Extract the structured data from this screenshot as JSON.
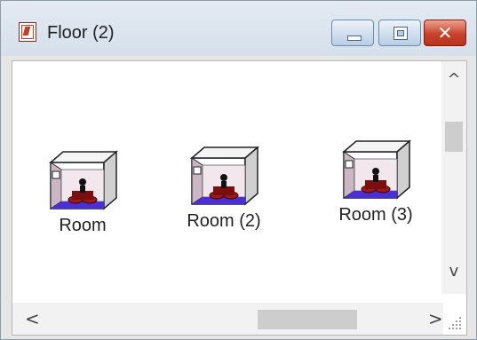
{
  "window": {
    "title": "Floor (2)",
    "controls": {
      "minimize": "minimize",
      "maximize": "maximize",
      "close": "x"
    }
  },
  "rooms": [
    {
      "label": "Room"
    },
    {
      "label": "Room (2)"
    },
    {
      "label": "Room (3)"
    }
  ],
  "icons": {
    "app": "floor-plan-icon",
    "room": "room-box-icon",
    "scroll_up": "chevron-up-icon",
    "scroll_down": "chevron-down-icon",
    "scroll_left": "chevron-left-icon",
    "scroll_right": "chevron-right-icon"
  },
  "glyphs": {
    "up": "^",
    "down": "v",
    "left": "<",
    "right": ">",
    "close": "✕"
  },
  "colors": {
    "floor": "#4a2fd6",
    "furniture": "#a01818",
    "close_button": "#c7422c"
  }
}
